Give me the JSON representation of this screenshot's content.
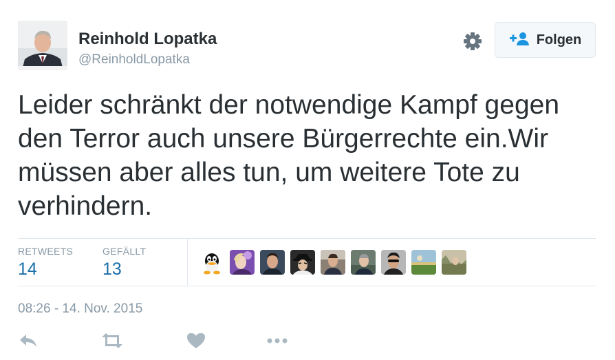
{
  "author": {
    "name": "Reinhold Lopatka",
    "handle": "@ReinholdLopatka"
  },
  "header": {
    "follow_label": "Folgen",
    "settings_icon": "gear-icon",
    "follow_icon": "add-user-icon"
  },
  "tweet": {
    "text": "Leider schränkt der notwendige Kampf gegen den Terror auch unsere Bürgerrechte ein.Wir müssen aber alles tun, um weitere Tote zu verhindern."
  },
  "stats": {
    "retweets_label": "RETWEETS",
    "retweets_value": "14",
    "likes_label": "GEFÄLLT",
    "likes_value": "13"
  },
  "likers": [
    {
      "icon": "duck-avatar"
    },
    {
      "icon": "person-avatar"
    },
    {
      "icon": "person-avatar"
    },
    {
      "icon": "person-avatar"
    },
    {
      "icon": "person-avatar"
    },
    {
      "icon": "person-avatar"
    },
    {
      "icon": "person-avatar"
    },
    {
      "icon": "landscape-avatar"
    },
    {
      "icon": "landscape-avatar"
    }
  ],
  "timestamp": "08:26 - 14. Nov. 2015",
  "actions": [
    "reply-icon",
    "retweet-icon",
    "heart-icon",
    "more-icon"
  ],
  "colors": {
    "text": "#292f33",
    "muted": "#8899a6",
    "stat_value": "#1b6fa8",
    "border": "#e1e8ed",
    "button_bg": "#f5f8fa",
    "icon_blue": "#1b95e0",
    "action_gray": "#aab8c2"
  }
}
